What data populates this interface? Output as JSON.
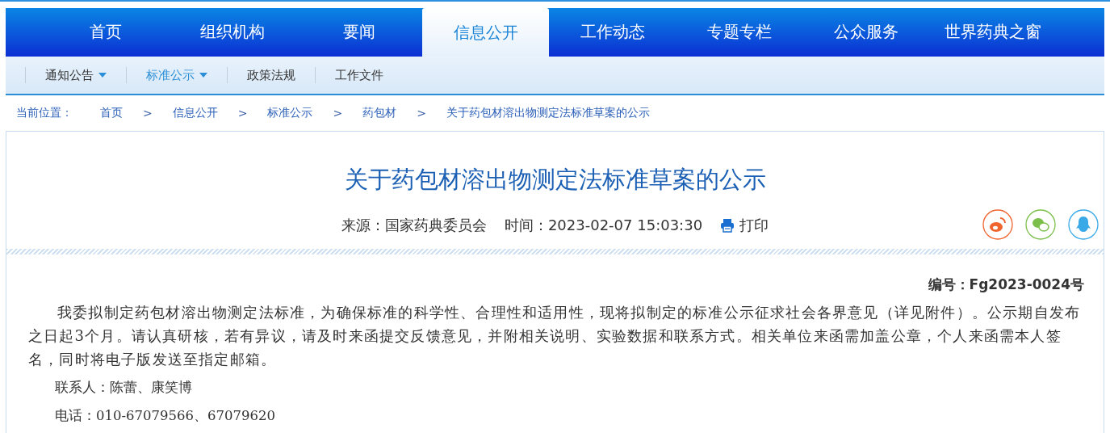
{
  "main_nav": [
    {
      "label": "首页",
      "selected": false
    },
    {
      "label": "组织机构",
      "selected": false
    },
    {
      "label": "要闻",
      "selected": false
    },
    {
      "label": "信息公开",
      "selected": true
    },
    {
      "label": "工作动态",
      "selected": false
    },
    {
      "label": "专题专栏",
      "selected": false
    },
    {
      "label": "公众服务",
      "selected": false
    },
    {
      "label": "世界药典之窗",
      "selected": false
    }
  ],
  "sub_nav": [
    {
      "label": "通知公告",
      "selected": false,
      "dropdown": true
    },
    {
      "label": "标准公示",
      "selected": true,
      "dropdown": true
    },
    {
      "label": "政策法规",
      "selected": false,
      "dropdown": false
    },
    {
      "label": "工作文件",
      "selected": false,
      "dropdown": false
    }
  ],
  "breadcrumb": {
    "label": "当前位置：",
    "separator": ">",
    "items": [
      "首页",
      "信息公开",
      "标准公示",
      "药包材",
      "关于药包材溶出物测定法标准草案的公示"
    ]
  },
  "article": {
    "title": "关于药包材溶出物测定法标准草案的公示",
    "source": "来源：国家药典委员会",
    "time": "时间：2023-02-07 15:03:30",
    "print": "打印",
    "share": [
      {
        "kind": "weibo"
      },
      {
        "kind": "wechat"
      },
      {
        "kind": "qq"
      }
    ],
    "number": "编号：Fg2023-0024号",
    "body": "我委拟制定药包材溶出物测定法标准，为确保标准的科学性、合理性和适用性，现将拟制定的标准公示征求社会各界意见（详见附件）。公示期自发布之日起3个月。请认真研核，若有异议，请及时来函提交反馈意见，并附相关说明、实验数据和联系方式。相关单位来函需加盖公章，个人来函需本人签名，同时将电子版发送至指定邮箱。",
    "contacts": [
      "联系人：陈蕾、康笑博",
      "电话：010-67079566、67079620"
    ]
  }
}
